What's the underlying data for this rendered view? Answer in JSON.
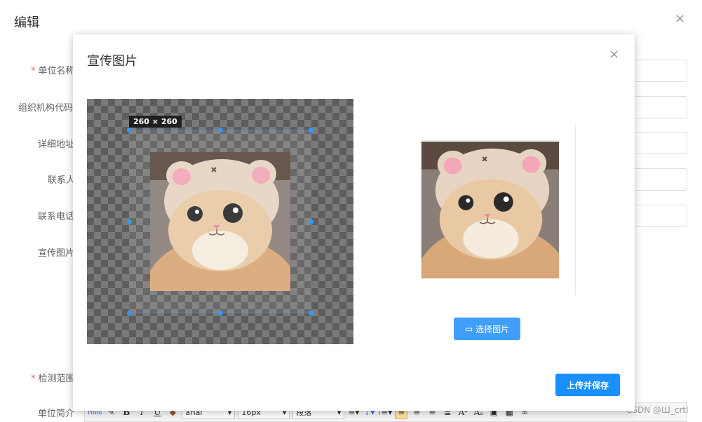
{
  "bg_dialog": {
    "title": "编辑",
    "close": "×",
    "labels": [
      "单位名称",
      "组织机构代码",
      "详细地址",
      "联系人",
      "联系电话",
      "宣传图片",
      "检测范围",
      "单位简介"
    ]
  },
  "toolbar": {
    "font_family": "arial",
    "font_size": "16px",
    "paragraph": "段落",
    "bold": "B",
    "italic": "I",
    "underline": "U"
  },
  "watermark": "CSDN @Ш_crtl",
  "modal": {
    "title": "宣传图片",
    "close": "×",
    "crop_size": "260 × 260",
    "choose_label": "选择图片",
    "upload_label": "上传并保存"
  },
  "colors": {
    "primary": "#409eff",
    "upload": "#1890ff",
    "handle": "#3399ff",
    "required": "#f56c6c"
  }
}
